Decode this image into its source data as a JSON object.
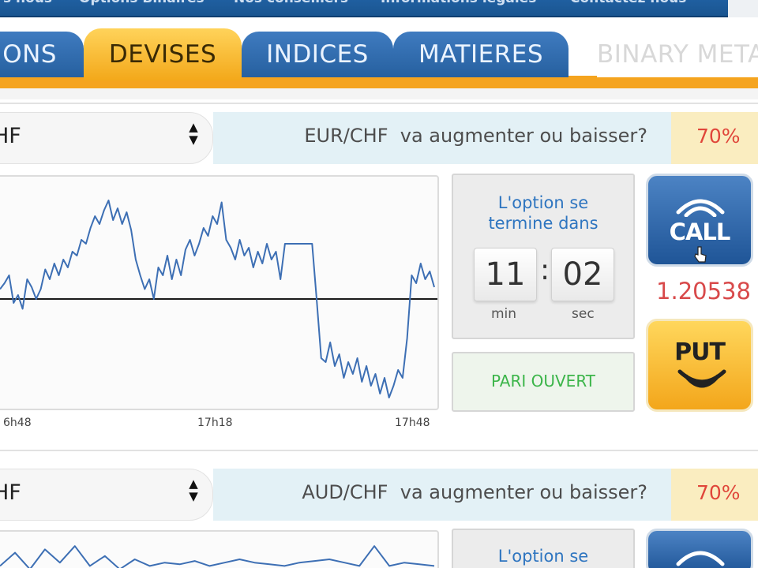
{
  "topnav": {
    "items": [
      "s nous",
      "Options Binaires",
      "Nos conseillers",
      "Informations légales",
      "Contactez nous"
    ]
  },
  "tabs": [
    {
      "label": "IONS",
      "state": "inactive"
    },
    {
      "label": "DEVISES",
      "state": "active"
    },
    {
      "label": "INDICES",
      "state": "inactive"
    },
    {
      "label": "MATIERES",
      "state": "inactive"
    },
    {
      "label": "BINARY META",
      "state": "faded"
    }
  ],
  "colors": {
    "nav_blue": "#1f5fa0",
    "tab_blue": "#2f6cb0",
    "tab_gold": "#f7b52a",
    "accent_orange": "#f5a41f",
    "percent_red": "#e0463a",
    "price_red": "#d8494a",
    "pari_green": "#3cb54a",
    "timer_blue": "#2e75c0",
    "series_blue": "#3d6fb4"
  },
  "sections": [
    {
      "selector": {
        "value": "HF",
        "icon": "updown-arrows-icon"
      },
      "question": {
        "pair": "EUR/CHF",
        "text": "va augmenter ou baisser?"
      },
      "percent": "70%",
      "timer": {
        "title_line1": "L'option se",
        "title_line2": "termine dans",
        "minutes": "11",
        "separator": ":",
        "seconds": "02",
        "min_label": "min",
        "sec_label": "sec"
      },
      "status": "PARI OUVERT",
      "call": {
        "label": "CALL",
        "icon": "signal-arcs-up-icon"
      },
      "price": "1.20538",
      "put": {
        "label": "PUT",
        "icon": "smile-arcs-down-icon"
      }
    },
    {
      "selector": {
        "value": "HF",
        "icon": "updown-arrows-icon"
      },
      "question": {
        "pair": "AUD/CHF",
        "text": "va augmenter ou baisser?"
      },
      "percent": "70%",
      "timer": {
        "title_line1": "L'option se"
      }
    }
  ],
  "chart_data": [
    {
      "type": "line",
      "x": [
        "6h48",
        "17h18",
        "17h48"
      ],
      "xlabel": "",
      "ylabel": "",
      "reference_line": true,
      "grid": false,
      "series": [
        {
          "values": [
            0.55,
            0.58,
            0.62,
            0.48,
            0.52,
            0.45,
            0.6,
            0.56,
            0.5,
            0.55,
            0.65,
            0.6,
            0.68,
            0.62,
            0.7,
            0.66,
            0.74,
            0.72,
            0.8,
            0.78,
            0.86,
            0.92,
            0.88,
            0.95,
            1.0,
            0.9,
            0.96,
            0.88,
            0.94,
            0.85,
            0.7,
            0.62,
            0.55,
            0.6,
            0.5,
            0.66,
            0.62,
            0.72,
            0.6,
            0.7,
            0.62,
            0.75,
            0.8,
            0.72,
            0.78,
            0.86,
            0.82,
            0.92,
            0.88,
            0.99,
            0.8,
            0.76,
            0.7,
            0.8,
            0.72,
            0.76,
            0.66,
            0.74,
            0.68,
            0.78,
            0.7,
            0.74,
            0.6,
            0.78,
            0.78,
            0.78,
            0.78,
            0.78,
            0.78,
            0.78,
            0.5,
            0.2,
            0.18,
            0.28,
            0.16,
            0.22,
            0.1,
            0.18,
            0.12,
            0.2,
            0.08,
            0.16,
            0.06,
            0.12,
            0.02,
            0.1,
            0.0,
            0.06,
            0.14,
            0.1,
            0.3,
            0.62,
            0.58,
            0.68,
            0.6,
            0.64,
            0.56
          ]
        }
      ]
    },
    {
      "type": "line",
      "x": [],
      "series": [
        {
          "values": [
            0.3,
            0.7,
            0.2,
            0.8,
            0.4,
            0.9,
            0.3,
            0.6,
            0.2,
            0.5,
            0.3,
            0.4,
            0.35,
            0.45,
            0.3,
            0.4,
            0.5,
            0.4,
            0.35,
            0.3,
            0.4,
            0.45,
            0.5,
            0.4,
            0.3,
            0.9,
            0.3,
            0.4,
            0.35,
            0.3
          ]
        }
      ]
    }
  ]
}
